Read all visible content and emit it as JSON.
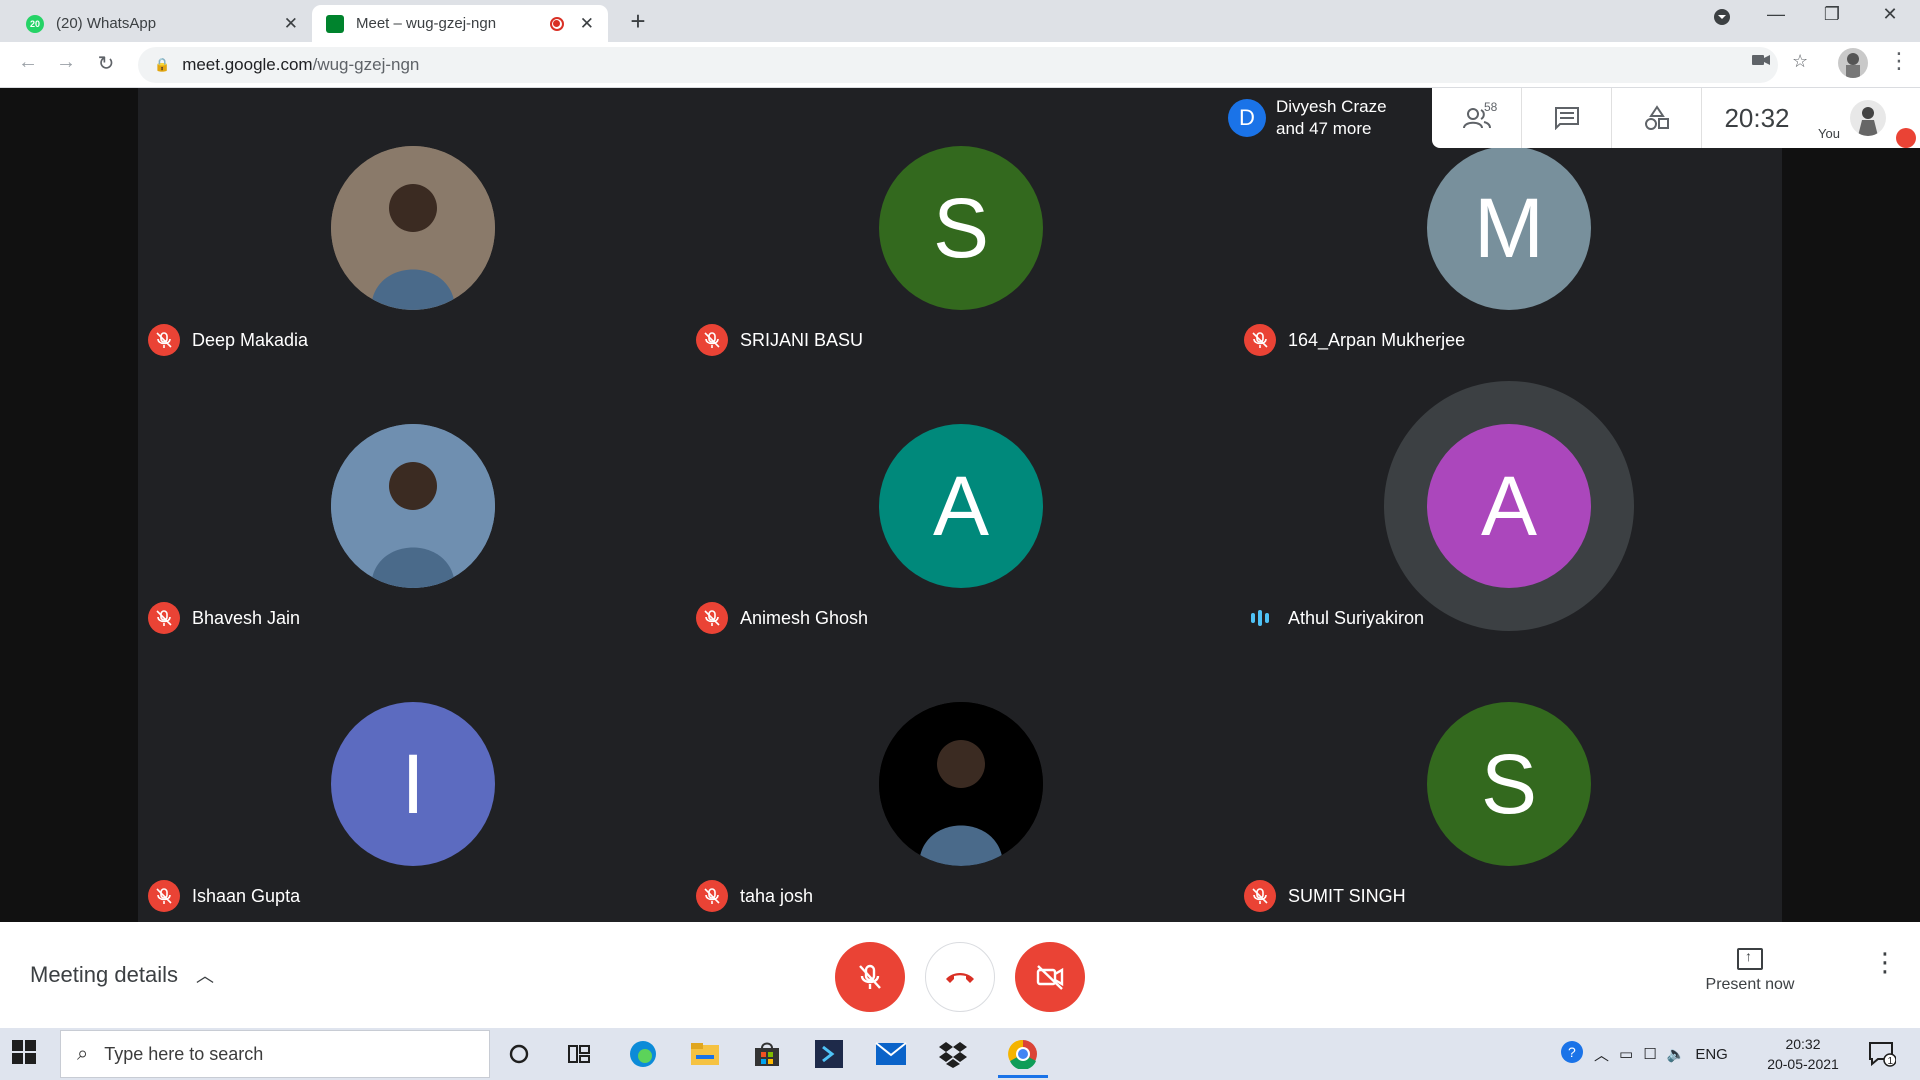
{
  "browser": {
    "tabs": [
      {
        "title": "(20) WhatsApp",
        "favicon_text": "20",
        "favicon_color": "#25d366",
        "active": false
      },
      {
        "title": "Meet – wug-gzej-ngn",
        "favicon_color": "#00832d",
        "active": true
      }
    ],
    "new_tab": "+",
    "url_domain": "meet.google.com",
    "url_path": "/wug-gzej-ngn"
  },
  "meet": {
    "presenter": {
      "initial": "D",
      "line1": "Divyesh Craze",
      "line2": "and 47 more"
    },
    "participants_count": "58",
    "clock": "20:32",
    "you_label": "You",
    "participants": [
      {
        "name": "Deep Makadia",
        "initial": "",
        "color": "#8a7a6a",
        "photo": true,
        "muted": true
      },
      {
        "name": "SRIJANI BASU",
        "initial": "S",
        "color": "#33691e",
        "muted": true
      },
      {
        "name": "164_Arpan Mukherjee",
        "initial": "M",
        "color": "#78909c",
        "muted": true
      },
      {
        "name": "Bhavesh Jain",
        "initial": "",
        "color": "#6f8fb0",
        "photo": true,
        "muted": true
      },
      {
        "name": "Animesh Ghosh",
        "initial": "A",
        "color": "#00897b",
        "muted": true
      },
      {
        "name": "Athul Suriyakiron",
        "initial": "A",
        "color": "#ab47bc",
        "muted": false,
        "speaking": true
      },
      {
        "name": "Ishaan Gupta",
        "initial": "I",
        "color": "#5c6bc0",
        "muted": true
      },
      {
        "name": "taha josh",
        "initial": "",
        "color": "#000000",
        "photo": true,
        "muted": true
      },
      {
        "name": "SUMIT SINGH",
        "initial": "S",
        "color": "#33691e",
        "muted": true
      }
    ]
  },
  "controls": {
    "meeting_details": "Meeting details",
    "present_now": "Present now"
  },
  "taskbar": {
    "search_placeholder": "Type here to search",
    "language": "ENG",
    "time": "20:32",
    "date": "20-05-2021",
    "notifications": "1"
  }
}
